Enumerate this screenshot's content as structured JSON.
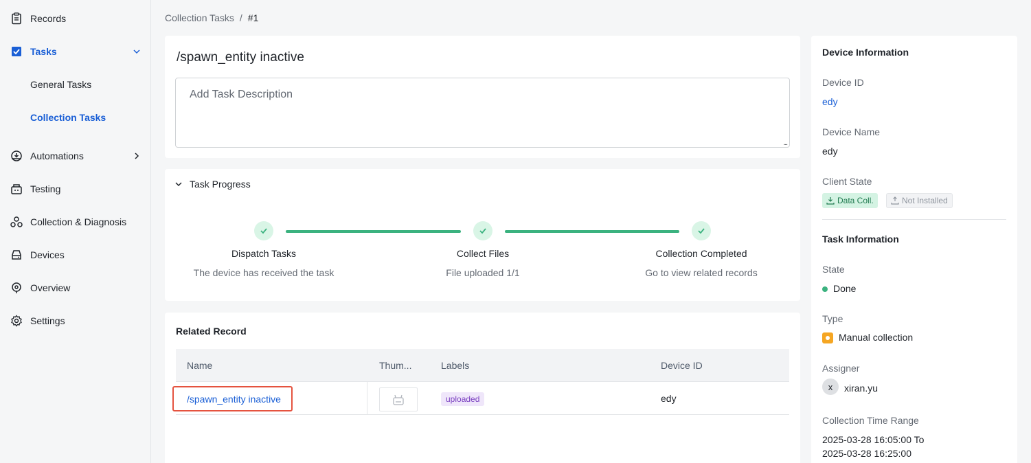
{
  "sidebar": {
    "items": [
      {
        "label": "Records",
        "icon": "clipboard-icon"
      },
      {
        "label": "Tasks",
        "icon": "tasks-icon"
      },
      {
        "label": "General Tasks"
      },
      {
        "label": "Collection Tasks"
      },
      {
        "label": "Automations",
        "icon": "automation-icon"
      },
      {
        "label": "Testing",
        "icon": "testing-icon"
      },
      {
        "label": "Collection & Diagnosis",
        "icon": "diagnosis-icon"
      },
      {
        "label": "Devices",
        "icon": "device-icon"
      },
      {
        "label": "Overview",
        "icon": "overview-icon"
      },
      {
        "label": "Settings",
        "icon": "gear-icon"
      }
    ]
  },
  "breadcrumb": {
    "parent": "Collection Tasks",
    "separator": "/",
    "current": "#1"
  },
  "task": {
    "title": "/spawn_entity inactive",
    "description_placeholder": "Add Task Description",
    "resize_grip": "..."
  },
  "progress": {
    "title": "Task Progress",
    "steps": [
      {
        "title": "Dispatch Tasks",
        "desc": "The device has received the task"
      },
      {
        "title": "Collect Files",
        "desc": "File uploaded 1/1"
      },
      {
        "title": "Collection Completed",
        "desc": "Go to view related records"
      }
    ]
  },
  "related": {
    "title": "Related Record",
    "columns": [
      "Name",
      "Thum...",
      "Labels",
      "Device ID"
    ],
    "rows": [
      {
        "name": "/spawn_entity inactive",
        "label": "uploaded",
        "device_id": "edy"
      }
    ]
  },
  "device_info": {
    "title": "Device Information",
    "device_id_label": "Device ID",
    "device_id": "edy",
    "device_name_label": "Device Name",
    "device_name": "edy",
    "client_state_label": "Client State",
    "badges": [
      "Data Coll.",
      "Not Installed"
    ]
  },
  "task_info": {
    "title": "Task Information",
    "state_label": "State",
    "state": "Done",
    "type_label": "Type",
    "type": "Manual collection",
    "assigner_label": "Assigner",
    "assigner_initial": "x",
    "assigner": "xiran.yu",
    "time_range_label": "Collection Time Range",
    "time_range_start": "2025-03-28 16:05:00 To",
    "time_range_end": "2025-03-28 16:25:00"
  },
  "colors": {
    "accent": "#1a5fd6",
    "success": "#3bb27f",
    "highlight": "#e5533f",
    "label_purple": "#7a3fc0"
  }
}
